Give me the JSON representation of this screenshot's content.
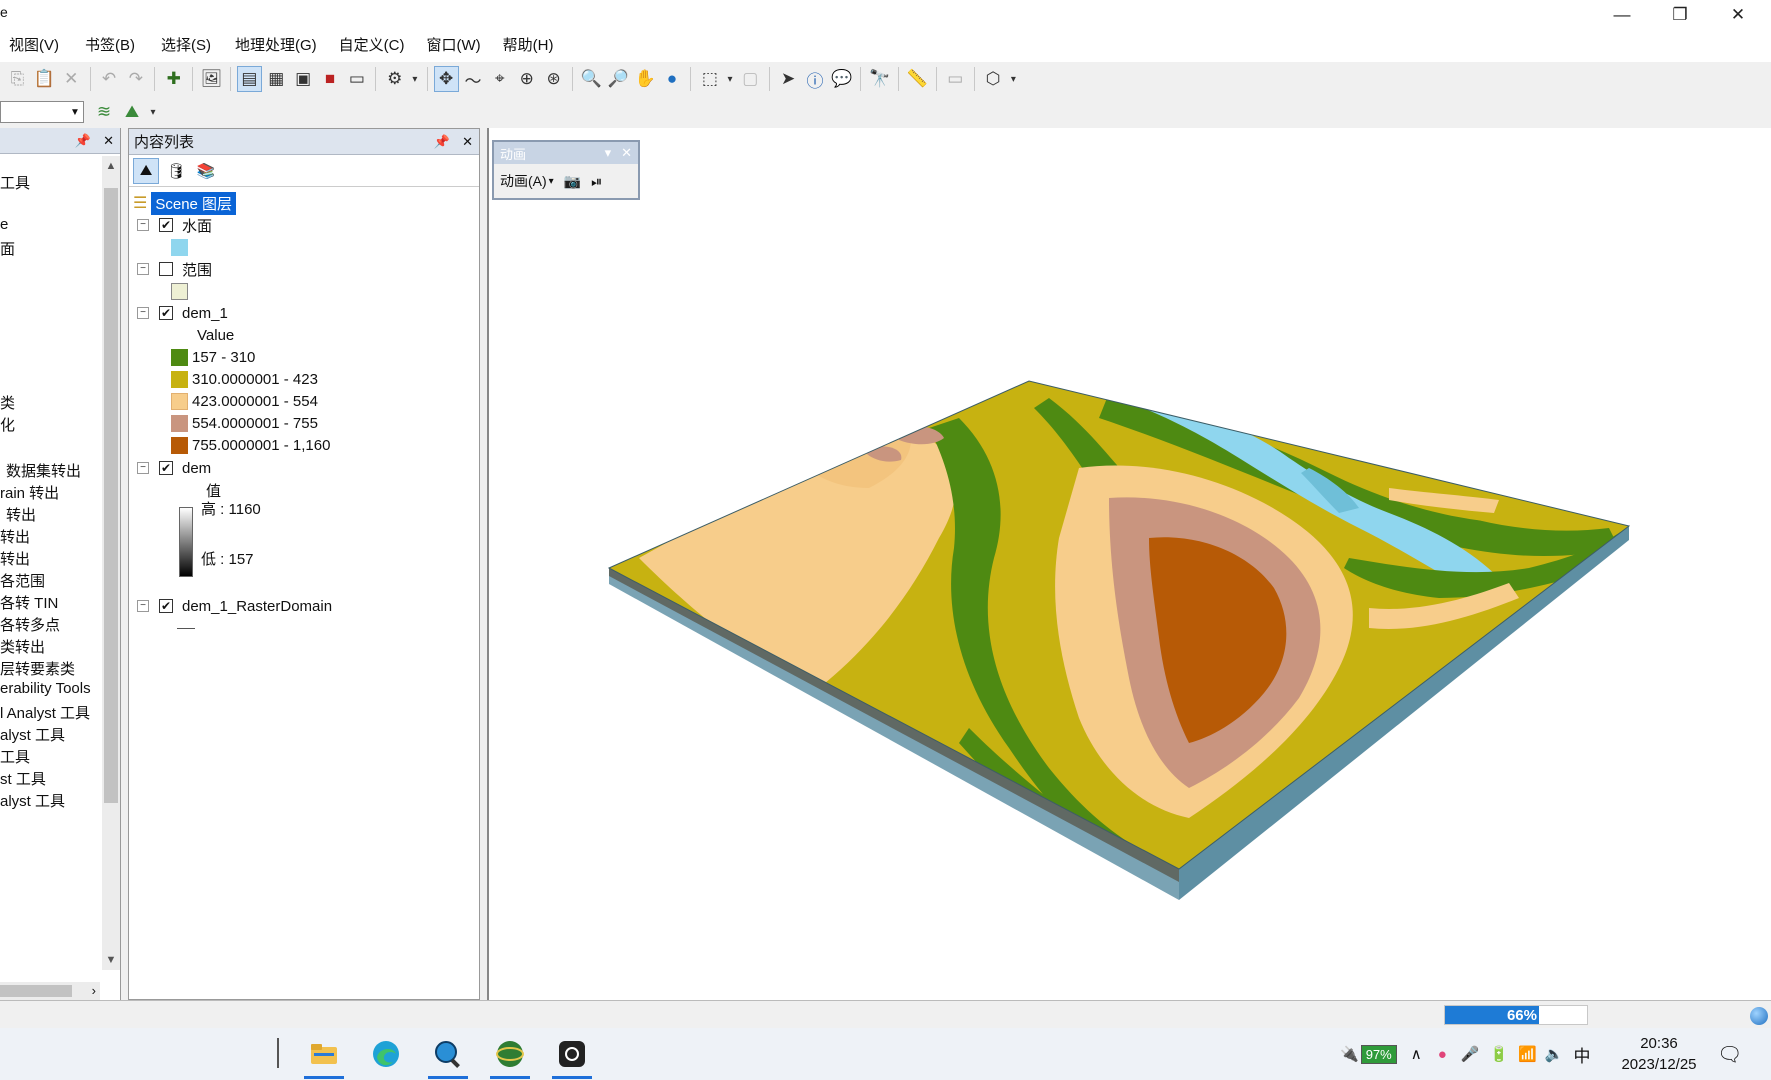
{
  "titlebar": {
    "app_letter": "e"
  },
  "menu": [
    "视图(V)",
    "书签(B)",
    "选择(S)",
    "地理处理(G)",
    "自定义(C)",
    "窗口(W)",
    "帮助(H)"
  ],
  "catalog": {
    "items": [
      "工具",
      "e",
      "面",
      "类",
      "化",
      "数据集转出",
      "rain 转出",
      "转出",
      "转出",
      "转出",
      "各范围",
      "各转 TIN",
      "各转多点",
      "类转出",
      "层转要素类",
      "erability Tools",
      "l Analyst 工具",
      "alyst 工具",
      "工具",
      "st 工具",
      "alyst 工具"
    ]
  },
  "toc": {
    "title": "内容列表",
    "root": "Scene 图层",
    "layers": {
      "water": {
        "name": "水面",
        "checked": true,
        "color": "#8fd6ee"
      },
      "extent": {
        "name": "范围",
        "checked": false,
        "color": "#eef0d4"
      },
      "dem1": {
        "name": "dem_1",
        "checked": true,
        "field": "Value",
        "classes": [
          {
            "label": "157 - 310",
            "color": "#4e8a12"
          },
          {
            "label": "310.0000001 - 423",
            "color": "#c7b211"
          },
          {
            "label": "423.0000001 - 554",
            "color": "#f7cd8b"
          },
          {
            "label": "554.0000001 - 755",
            "color": "#c9957f"
          },
          {
            "label": "755.0000001 - 1,160",
            "color": "#b75a06"
          }
        ]
      },
      "dem": {
        "name": "dem",
        "checked": true,
        "field": "值",
        "high": "高 : 1160",
        "low": "低 : 157"
      },
      "domain": {
        "name": "dem_1_RasterDomain",
        "checked": true
      }
    }
  },
  "animation": {
    "title": "动画",
    "menu": "动画(A)"
  },
  "status": {
    "progress": 0.66,
    "progress_label": "66%"
  },
  "taskbar": {
    "battery": "97%",
    "ime": "中",
    "time": "20:36",
    "date": "2023/12/25"
  }
}
